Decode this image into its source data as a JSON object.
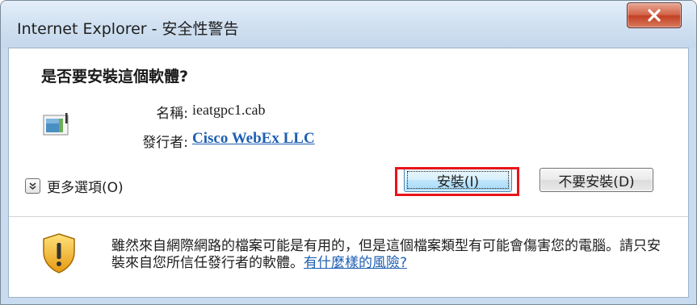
{
  "window": {
    "title": "Internet Explorer - 安全性警告",
    "close_icon": "close-icon"
  },
  "dialog": {
    "question": "是否要安裝這個軟體?",
    "file_icon": "cab-file-icon",
    "name_label": "名稱:",
    "name_value": "ieatgpc1.cab",
    "publisher_label": "發行者:",
    "publisher_value": "Cisco WebEx LLC",
    "more_options_label": "更多選項(O)",
    "more_options_icon": "chevron-down-icon",
    "install_button": "安裝(I)",
    "dont_install_button": "不要安裝(D)"
  },
  "warning": {
    "icon": "shield-warning-icon",
    "text": "雖然來自網際網路的檔案可能是有用的，但是這個檔案類型有可能會傷害您的電腦。請只安裝來自您所信任發行者的軟體。",
    "link": "有什麼樣的風險?"
  },
  "annotation": {
    "highlight_color": "#e8141a",
    "highlight_target": "install-button"
  }
}
